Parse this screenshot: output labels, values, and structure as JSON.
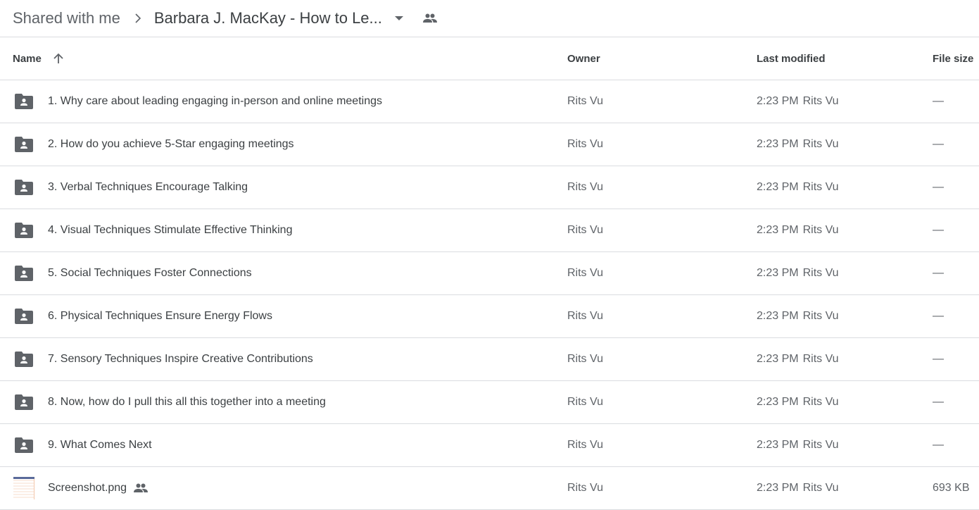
{
  "breadcrumb": {
    "root": "Shared with me",
    "separator_icon": "chevron-right-icon",
    "current": "Barbara J. MacKay - How to Le...",
    "dropdown_icon": "caret-down-icon",
    "shared_icon": "people-icon"
  },
  "columns": {
    "name": "Name",
    "sort_icon": "arrow-up-icon",
    "owner": "Owner",
    "last_modified": "Last modified",
    "file_size": "File size"
  },
  "rows": [
    {
      "type": "shared-folder",
      "name": "1. Why care about leading engaging in-person and online meetings",
      "owner": "Rits Vu",
      "modified_time": "2:23 PM",
      "modified_by": "Rits Vu",
      "size": "—"
    },
    {
      "type": "shared-folder",
      "name": "2. How do you achieve 5-Star engaging meetings",
      "owner": "Rits Vu",
      "modified_time": "2:23 PM",
      "modified_by": "Rits Vu",
      "size": "—"
    },
    {
      "type": "shared-folder",
      "name": "3. Verbal Techniques Encourage Talking",
      "owner": "Rits Vu",
      "modified_time": "2:23 PM",
      "modified_by": "Rits Vu",
      "size": "—"
    },
    {
      "type": "shared-folder",
      "name": "4. Visual Techniques Stimulate Effective Thinking",
      "owner": "Rits Vu",
      "modified_time": "2:23 PM",
      "modified_by": "Rits Vu",
      "size": "—"
    },
    {
      "type": "shared-folder",
      "name": "5. Social Techniques Foster Connections",
      "owner": "Rits Vu",
      "modified_time": "2:23 PM",
      "modified_by": "Rits Vu",
      "size": "—"
    },
    {
      "type": "shared-folder",
      "name": "6. Physical Techniques Ensure Energy Flows",
      "owner": "Rits Vu",
      "modified_time": "2:23 PM",
      "modified_by": "Rits Vu",
      "size": "—"
    },
    {
      "type": "shared-folder",
      "name": "7. Sensory Techniques Inspire Creative Contributions",
      "owner": "Rits Vu",
      "modified_time": "2:23 PM",
      "modified_by": "Rits Vu",
      "size": "—"
    },
    {
      "type": "shared-folder",
      "name": "8. Now, how do I pull this all this together into a meeting",
      "owner": "Rits Vu",
      "modified_time": "2:23 PM",
      "modified_by": "Rits Vu",
      "size": "—"
    },
    {
      "type": "shared-folder",
      "name": "9. What Comes Next",
      "owner": "Rits Vu",
      "modified_time": "2:23 PM",
      "modified_by": "Rits Vu",
      "size": "—"
    },
    {
      "type": "image",
      "name": "Screenshot.png",
      "shared": true,
      "owner": "Rits Vu",
      "modified_time": "2:23 PM",
      "modified_by": "Rits Vu",
      "size": "693 KB"
    }
  ]
}
